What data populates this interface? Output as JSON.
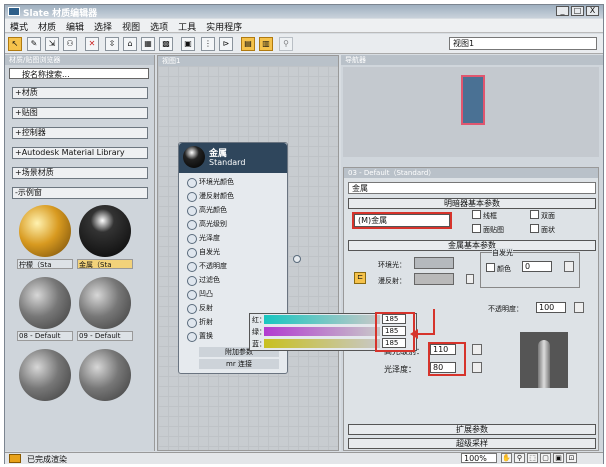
{
  "window": {
    "title": "Slate 材质编辑器",
    "buttons": [
      "_",
      "□",
      "X"
    ]
  },
  "menu": [
    "模式",
    "材质",
    "编辑",
    "选择",
    "视图",
    "选项",
    "工具",
    "实用程序"
  ],
  "toolbar": {
    "view_selector": "视图1"
  },
  "browser": {
    "header": "材质/贴图浏览器",
    "search": "按名称搜索...",
    "rollouts": [
      "+材质",
      "+贴图",
      "+控制器",
      "+Autodesk Material Library",
      "+场景材质",
      "-示例窗"
    ],
    "swatches": [
      {
        "label": "柠檬（Sta"
      },
      {
        "label": "金属（Sta"
      },
      {
        "label": "08 - Default"
      },
      {
        "label": "09 - Default"
      }
    ]
  },
  "view": {
    "tab": "视图1",
    "node": {
      "name": "金属",
      "type": "Standard",
      "slots": [
        "环境光颜色",
        "漫反射颜色",
        "高光颜色",
        "高光级别",
        "光泽度",
        "自发光",
        "不透明度",
        "过滤色",
        "凹凸",
        "反射",
        "折射",
        "置换"
      ],
      "footer1": "附加参数",
      "footer2": "mr 连接"
    }
  },
  "navigator": {
    "header": "导航器"
  },
  "material": {
    "header": "03 - Default（Standard）",
    "name": "金属",
    "basic_header": "明暗器基本参数",
    "shader": "(M)金属",
    "checks": [
      "线框",
      "双面",
      "面贴图",
      "面状"
    ],
    "metal_header": "金属基本参数",
    "ambient_label": "环境光：",
    "diffuse_label": "漫反射：",
    "selfillum": "自发光",
    "color_label": "颜色",
    "color_val": "0",
    "opacity_label": "不透明度：",
    "opacity_val": "100",
    "spec_level_label": "高光级别：",
    "spec_level": "110",
    "gloss_label": "光泽度：",
    "gloss": "80",
    "expand_header": "扩展参数",
    "super_header": "超级采样"
  },
  "colorpicker": {
    "r_label": "红：",
    "r": "185",
    "g_label": "绿：",
    "g": "185",
    "b_label": "蓝：",
    "b": "185"
  },
  "status": {
    "text": "已完成渲染",
    "zoom": "100%"
  }
}
